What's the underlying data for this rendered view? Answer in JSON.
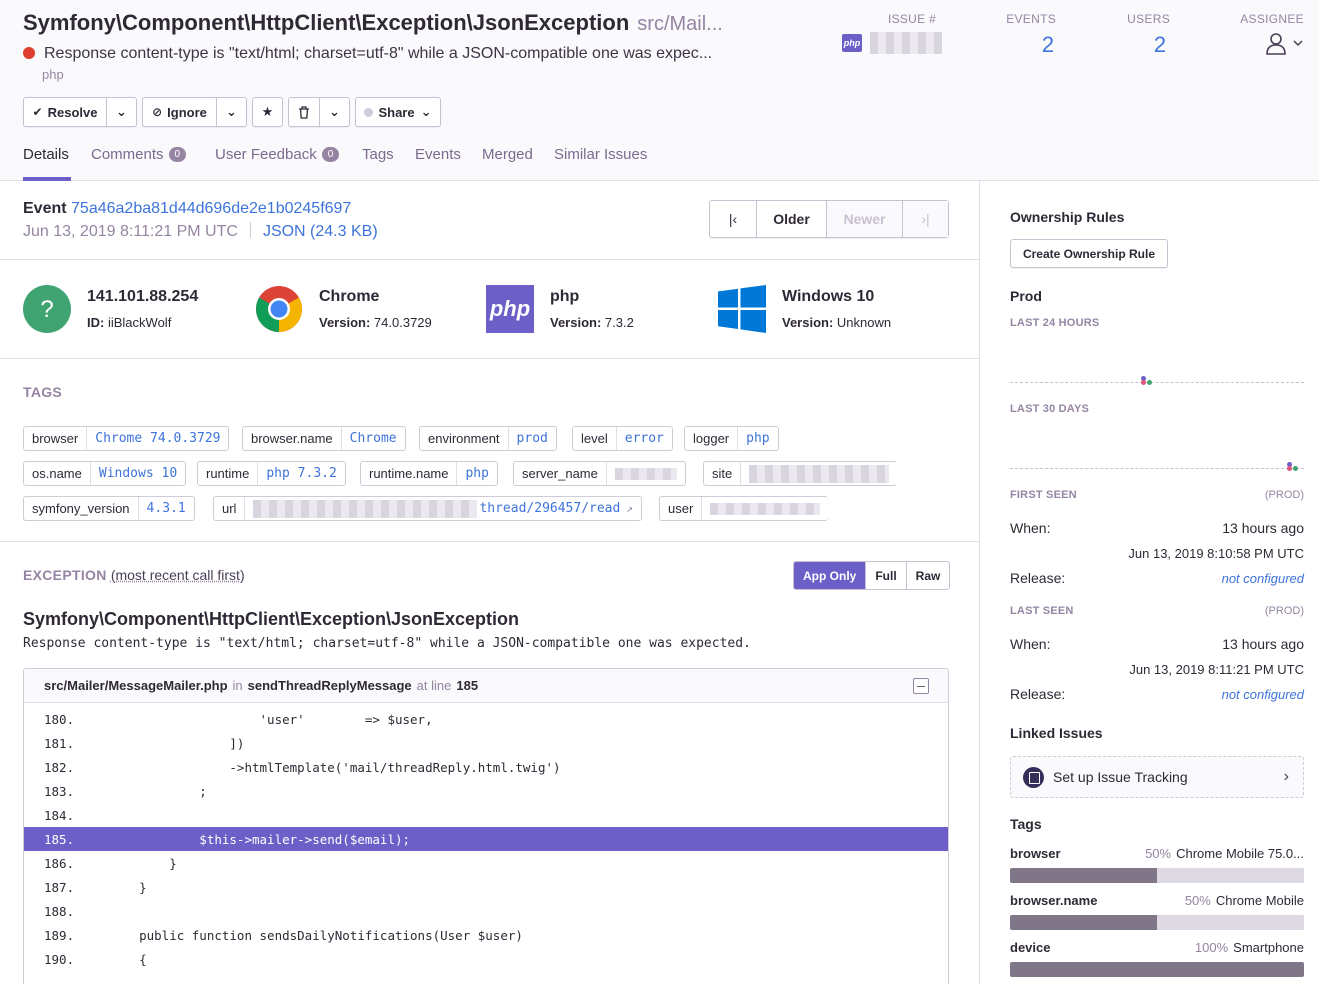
{
  "issue": {
    "title": "Symfony\\Component\\HttpClient\\Exception\\JsonException",
    "culprit": "src/Mail...",
    "message": "Response content-type is \"text/html; charset=utf-8\" while a JSON-compatible one was expec...",
    "platform": "php",
    "level_color": "#e03e2f"
  },
  "stats": {
    "issue_label": "ISSUE #",
    "issue_badge": "php",
    "events_label": "EVENTS",
    "events_value": "2",
    "users_label": "USERS",
    "users_value": "2",
    "assignee_label": "ASSIGNEE"
  },
  "actions": {
    "resolve": "Resolve",
    "ignore": "Ignore",
    "share": "Share"
  },
  "tabs": [
    {
      "label": "Details"
    },
    {
      "label": "Comments",
      "badge": "0"
    },
    {
      "label": "User Feedback",
      "badge": "0"
    },
    {
      "label": "Tags"
    },
    {
      "label": "Events"
    },
    {
      "label": "Merged"
    },
    {
      "label": "Similar Issues"
    }
  ],
  "event": {
    "label": "Event",
    "id": "75a46a2ba81d44d696de2e1b0245f697",
    "date": "Jun 13, 2019 8:11:21 PM UTC",
    "json_link": "JSON (24.3 KB)",
    "pager": {
      "older": "Older",
      "newer": "Newer"
    }
  },
  "contexts": [
    {
      "icon": "user-icon",
      "name": "141.101.88.254",
      "sub_label": "ID:",
      "sub_value": "iiBlackWolf"
    },
    {
      "icon": "chrome-icon",
      "name": "Chrome",
      "sub_label": "Version:",
      "sub_value": "74.0.3729"
    },
    {
      "icon": "php-icon",
      "name": "php",
      "sub_label": "Version:",
      "sub_value": "7.3.2"
    },
    {
      "icon": "windows-icon",
      "name": "Windows 10",
      "sub_label": "Version:",
      "sub_value": "Unknown"
    }
  ],
  "tags_heading": "TAGS",
  "tags": [
    {
      "key": "browser",
      "value": "Chrome 74.0.3729"
    },
    {
      "key": "browser.name",
      "value": "Chrome"
    },
    {
      "key": "environment",
      "value": "prod"
    },
    {
      "key": "level",
      "value": "error"
    },
    {
      "key": "logger",
      "value": "php"
    },
    {
      "key": "os.name",
      "value": "Windows 10"
    },
    {
      "key": "runtime",
      "value": "php 7.3.2"
    },
    {
      "key": "runtime.name",
      "value": "php"
    },
    {
      "key": "server_name",
      "value": ""
    },
    {
      "key": "site",
      "value": ""
    },
    {
      "key": "symfony_version",
      "value": "4.3.1"
    },
    {
      "key": "url",
      "value": "thread/296457/read"
    },
    {
      "key": "user",
      "value": ""
    }
  ],
  "exception": {
    "heading": "EXCEPTION",
    "heading_note": "(most recent call first)",
    "toggle": [
      "App Only",
      "Full",
      "Raw"
    ],
    "type": "Symfony\\Component\\HttpClient\\Exception\\JsonException",
    "value": "Response content-type is \"text/html; charset=utf-8\" while a JSON-compatible one was expected.",
    "frame": {
      "file": "src/Mailer/MessageMailer.php",
      "in_label": "in",
      "function": "sendThreadReplyMessage",
      "at_line_label": "at line",
      "line": "185",
      "lines": [
        {
          "no": "180.",
          "code": "                    'user'        => $user,"
        },
        {
          "no": "181.",
          "code": "                ])"
        },
        {
          "no": "182.",
          "code": "                ->htmlTemplate('mail/threadReply.html.twig')"
        },
        {
          "no": "183.",
          "code": "            ;"
        },
        {
          "no": "184.",
          "code": ""
        },
        {
          "no": "185.",
          "code": "            $this->mailer->send($email);"
        },
        {
          "no": "186.",
          "code": "        }"
        },
        {
          "no": "187.",
          "code": "    }"
        },
        {
          "no": "188.",
          "code": ""
        },
        {
          "no": "189.",
          "code": "    public function sendsDailyNotifications(User $user)"
        },
        {
          "no": "190.",
          "code": "    {"
        }
      ]
    }
  },
  "sidebar": {
    "ownership_title": "Ownership Rules",
    "ownership_button": "Create Ownership Rule",
    "env_title": "Prod",
    "last24": "LAST 24 HOURS",
    "last30": "LAST 30 DAYS",
    "first_seen": {
      "label": "FIRST SEEN",
      "env": "(PROD)",
      "when_label": "When:",
      "when": "13 hours ago",
      "date": "Jun 13, 2019 8:10:58 PM UTC",
      "release_label": "Release:",
      "release": "not configured"
    },
    "last_seen": {
      "label": "LAST SEEN",
      "env": "(PROD)",
      "when_label": "When:",
      "when": "13 hours ago",
      "date": "Jun 13, 2019 8:11:21 PM UTC",
      "release_label": "Release:",
      "release": "not configured"
    },
    "linked_title": "Linked Issues",
    "linked_button": "Set up Issue Tracking",
    "tags_title": "Tags",
    "tag_stats": [
      {
        "key": "browser",
        "pct": "50%",
        "value": "Chrome Mobile 75.0...",
        "fraction": 0.5
      },
      {
        "key": "browser.name",
        "pct": "50%",
        "value": "Chrome Mobile",
        "fraction": 0.5
      },
      {
        "key": "device",
        "pct": "100%",
        "value": "Smartphone",
        "fraction": 1.0
      }
    ]
  },
  "colors": {
    "accent": "#6c5fc7",
    "link": "#3d74db",
    "error": "#e03e2f"
  }
}
